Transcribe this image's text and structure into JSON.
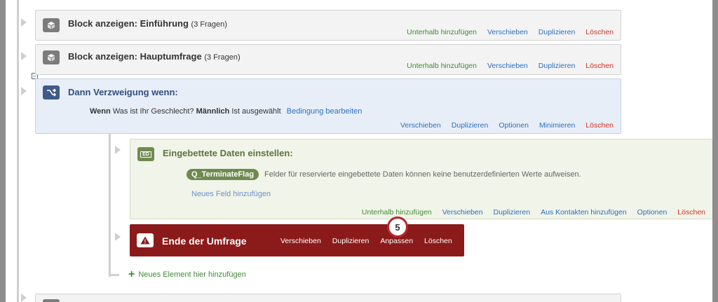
{
  "blocks": [
    {
      "title": "Block anzeigen: Einführung",
      "count": "(3 Fragen)",
      "actions": [
        "Unterhalb hinzufügen",
        "Verschieben",
        "Duplizieren",
        "Löschen"
      ]
    },
    {
      "title": "Block anzeigen: Hauptumfrage",
      "count": "(3 Fragen)",
      "actions": [
        "Unterhalb hinzufügen",
        "Verschieben",
        "Duplizieren",
        "Löschen"
      ]
    }
  ],
  "collapse_toggle": "−",
  "branch": {
    "title": "Dann Verzweigung wenn:",
    "cond_keyword": "Wenn",
    "cond_question": "Was ist Ihr Geschlecht?",
    "cond_answer": "Männlich",
    "cond_state": "Ist ausgewählt",
    "cond_edit": "Bedingung bearbeiten",
    "actions": [
      "Verschieben",
      "Duplizieren",
      "Optionen",
      "Minimieren",
      "Löschen"
    ]
  },
  "embedded": {
    "icon_text": "ED",
    "title": "Eingebettete Daten einstellen:",
    "field": "Q_TerminateFlag",
    "message": "Felder für reservierte eingebettete Daten können keine benutzerdefinierten Werte aufweisen.",
    "add_field": "Neues Feld hinzufügen",
    "actions": [
      "Unterhalb hinzufügen",
      "Verschieben",
      "Duplizieren",
      "Aus Kontakten hinzufügen",
      "Optionen",
      "Löschen"
    ]
  },
  "end": {
    "icon_text": "!",
    "title": "Ende der Umfrage",
    "actions": [
      "Verschieben",
      "Duplizieren",
      "Anpassen",
      "Löschen"
    ]
  },
  "step_badge": "5",
  "add_element": {
    "plus": "+",
    "label": "Neues Element hier hinzufügen"
  },
  "colors": {
    "green": "#3f8c35",
    "blue": "#2c6fbf",
    "red": "#cc3427",
    "end_bg": "#8b1a1a",
    "branch_icon": "#3d5a8a",
    "badge": "#b8262b"
  }
}
